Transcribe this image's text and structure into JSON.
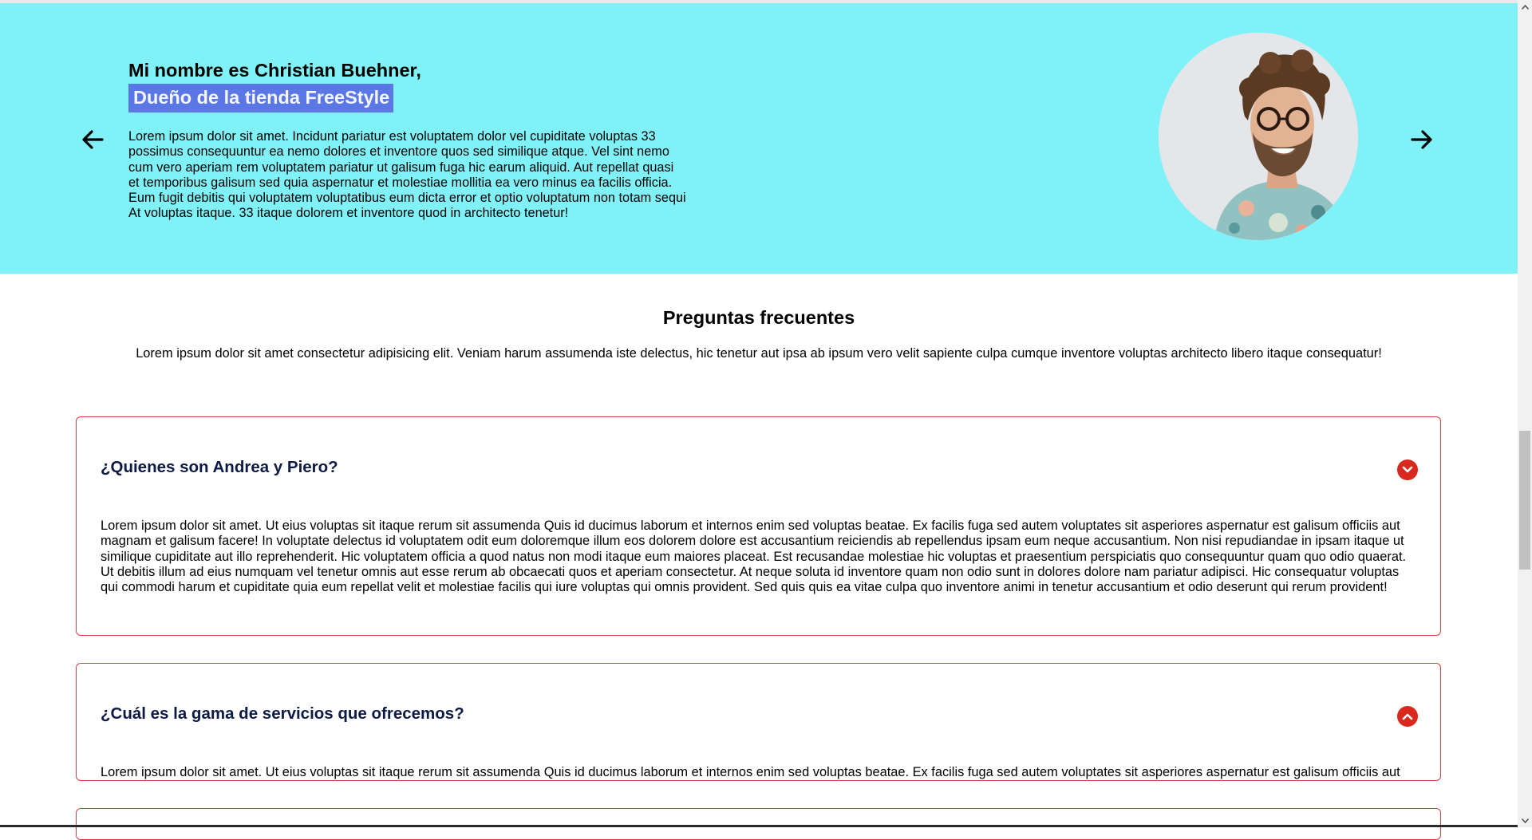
{
  "hero": {
    "name_line": "Mi nombre es Christian Buehner,",
    "role_line": "Dueño de la tienda FreeStyle",
    "body": "Lorem ipsum dolor sit amet. Incidunt pariatur est voluptatem dolor vel cupiditate voluptas 33 possimus consequuntur ea nemo dolores et inventore quos sed similique atque. Vel sint nemo cum vero aperiam rem voluptatem pariatur ut galisum fuga hic earum aliquid. Aut repellat quasi et temporibus galisum sed quia aspernatur et molestiae mollitia ea vero minus ea facilis officia. Eum fugit debitis qui voluptatem voluptatibus eum dicta error et optio voluptatum non totam sequi At voluptas itaque. 33 itaque dolorem et inventore quod in architecto tenetur!",
    "prev_icon": "arrow-left-icon",
    "next_icon": "arrow-right-icon",
    "background_color": "#80f2f7",
    "role_highlight_color": "#5b76e5"
  },
  "faq": {
    "title": "Preguntas frecuentes",
    "intro": "Lorem ipsum dolor sit amet consectetur adipisicing elit. Veniam harum assumenda iste delectus, hic tenetur aut ipsa ab ipsum vero velit sapiente culpa cumque inventore voluptas architecto libero itaque consequatur!",
    "border_color": "#e23b3b",
    "toggle_color": "#d9281e",
    "items": [
      {
        "question": "¿Quienes son Andrea y Piero?",
        "answer": "Lorem ipsum dolor sit amet. Ut eius voluptas sit itaque rerum sit assumenda Quis id ducimus laborum et internos enim sed voluptas beatae. Ex facilis fuga sed autem voluptates sit asperiores aspernatur est galisum officiis aut magnam et galisum facere! In voluptate delectus id voluptatem odit eum doloremque illum eos dolorem dolore est accusantium reiciendis ab repellendus ipsam eum neque accusantium. Non nisi repudiandae in ipsam itaque ut similique cupiditate aut illo reprehenderit. Hic voluptatem officia a quod natus non modi itaque eum maiores placeat. Est recusandae molestiae hic voluptas et praesentium perspiciatis quo consequuntur quam quo odio quaerat. Ut debitis illum ad eius numquam vel tenetur omnis aut esse rerum ab obcaecati quos et aperiam consectetur. At neque soluta id inventore quam non odio sunt in dolores dolore nam pariatur adipisci. Hic consequatur voluptas qui commodi harum et cupiditate quia eum repellat velit et molestiae facilis qui iure voluptas qui omnis provident. Sed quis quis ea vitae culpa quo inventore animi in tenetur accusantium et odio deserunt qui rerum provident!",
        "toggle_icon": "chevron-down-icon"
      },
      {
        "question": "¿Cuál es la gama de servicios que ofrecemos?",
        "answer": "Lorem ipsum dolor sit amet. Ut eius voluptas sit itaque rerum sit assumenda Quis id ducimus laborum et internos enim sed voluptas beatae. Ex facilis fuga sed autem voluptates sit asperiores aspernatur est galisum officiis aut",
        "toggle_icon": "chevron-up-icon"
      }
    ]
  }
}
